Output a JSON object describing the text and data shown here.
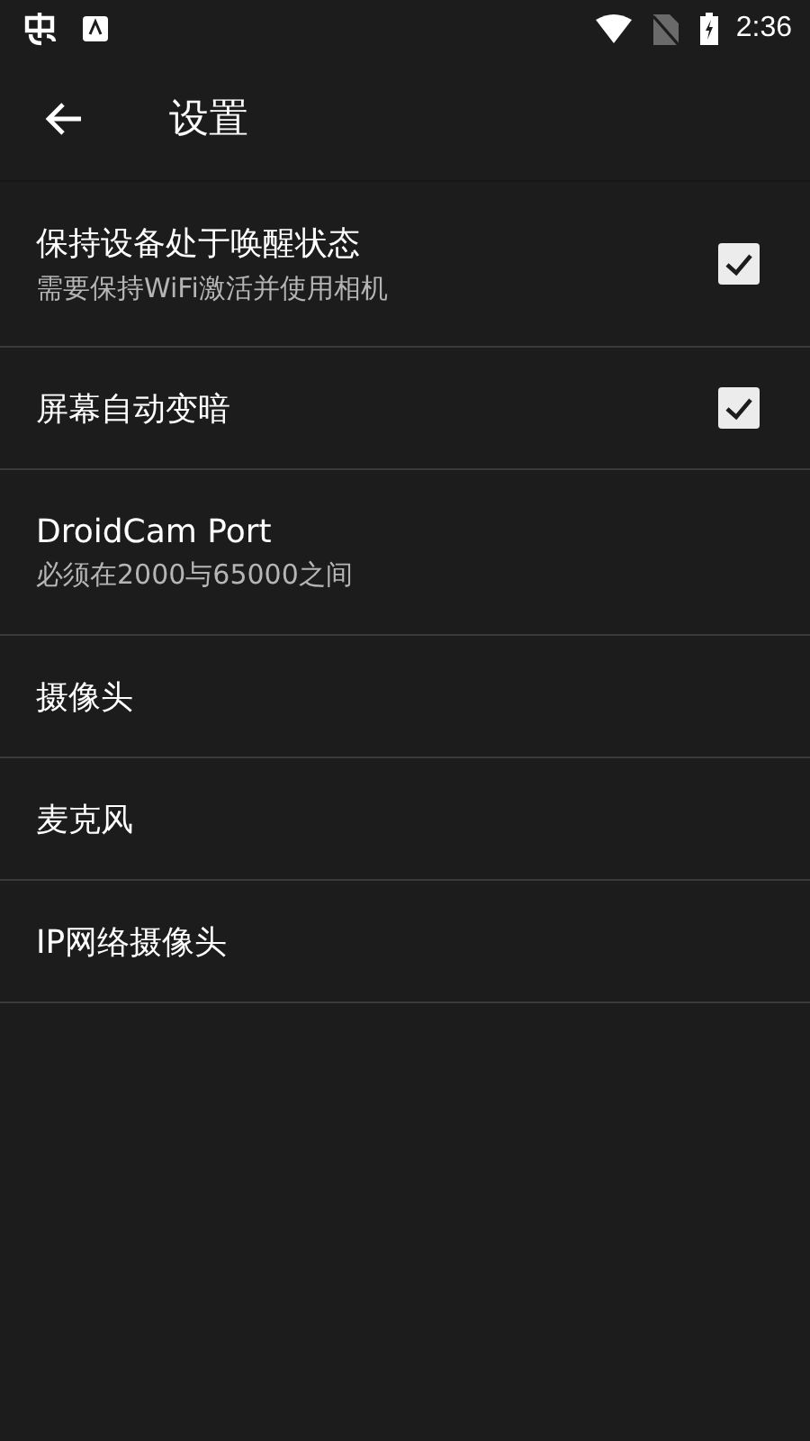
{
  "status_bar": {
    "time": "2:36"
  },
  "toolbar": {
    "title": "设置"
  },
  "settings": [
    {
      "kind": "checkbox",
      "title": "保持设备处于唤醒状态",
      "summary": "需要保持WiFi激活并使用相机",
      "checked": true
    },
    {
      "kind": "checkbox",
      "title": "屏幕自动变暗",
      "checked": true
    },
    {
      "kind": "plain",
      "title": "DroidCam Port",
      "summary": "必须在2000与65000之间"
    },
    {
      "kind": "plain",
      "title": "摄像头"
    },
    {
      "kind": "plain",
      "title": "麦克风"
    },
    {
      "kind": "plain",
      "title": "IP网络摄像头"
    }
  ]
}
